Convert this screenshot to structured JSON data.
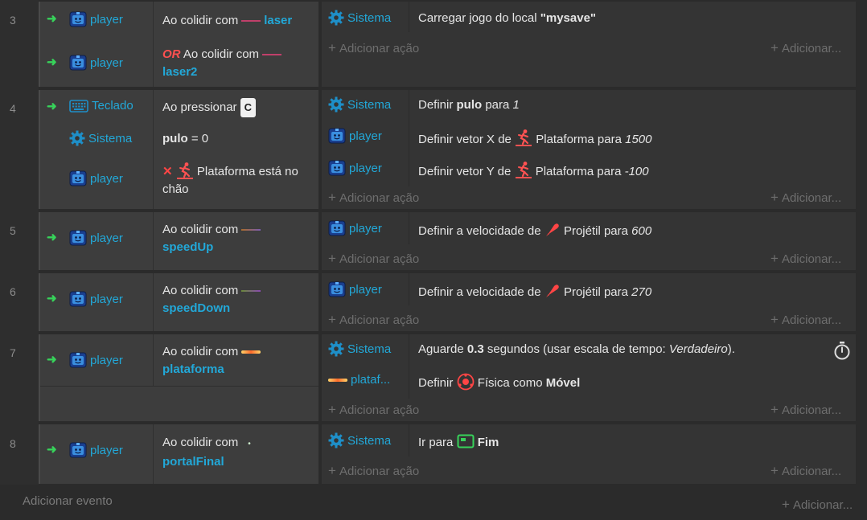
{
  "labels": {
    "player": "player",
    "sistema": "Sistema",
    "teclado": "Teclado",
    "plataf": "plataf...",
    "adicionar_acao": "Adicionar ação",
    "adicionar_right": "Adicionar...",
    "adicionar_evento": "Adicionar evento",
    "ao_colidir_com": "Ao colidir com",
    "or": "OR",
    "plus": "+"
  },
  "events": [
    {
      "num": "3",
      "cond1_obj": "laser",
      "cond2_obj": "laser2",
      "act1_pre": "Carregar jogo do local ",
      "act1_val": "\"mysave\""
    },
    {
      "num": "4",
      "cond1_pre": "Ao pressionar",
      "cond1_key": "C",
      "cond2_var": "pulo",
      "cond2_rest": " = 0",
      "cond3_text": "Plataforma está no chão",
      "act1_pre": "Definir ",
      "act1_var": "pulo",
      "act1_mid": " para ",
      "act1_val": "1",
      "act2_pre": "Definir vetor X de",
      "act2_beh": "Plataforma para ",
      "act2_val": "1500",
      "act3_pre": "Definir vetor Y de",
      "act3_beh": "Plataforma para ",
      "act3_val": "-100"
    },
    {
      "num": "5",
      "cond_obj": "speedUp",
      "act_pre": "Definir a velocidade de",
      "act_beh": "Projétil para ",
      "act_val": "600"
    },
    {
      "num": "6",
      "cond_obj": "speedDown",
      "act_pre": "Definir a velocidade de",
      "act_beh": "Projétil para ",
      "act_val": "270"
    },
    {
      "num": "7",
      "cond_obj": "plataforma",
      "act1_pre": "Aguarde ",
      "act1_num": "0.3",
      "act1_mid": " segundos (usar escala de tempo: ",
      "act1_val": "Verdadeiro",
      "act1_end": ").",
      "act2_pre": "Definir",
      "act2_beh": "Física como ",
      "act2_val": "Móvel"
    },
    {
      "num": "8",
      "cond_obj": "portalFinal",
      "act_pre": "Ir para",
      "act_val": "Fim"
    }
  ]
}
